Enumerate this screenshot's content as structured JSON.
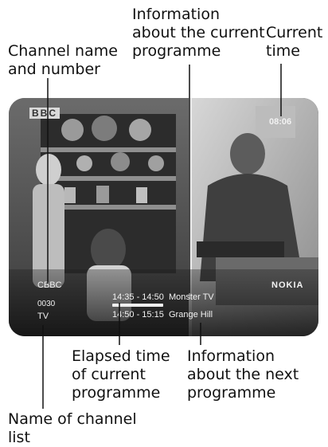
{
  "callouts": {
    "channel_name_number": "Channel name\nand number",
    "current_programme_info": "Information\nabout the current\nprogramme",
    "current_time": "Current\ntime",
    "elapsed_time": "Elapsed time\nof current\nprogramme",
    "next_programme_info": "Information\nabout the next\nprogramme",
    "channel_list_name": "Name of channel\nlist"
  },
  "tv_screen": {
    "logo": "BBC",
    "clock": "08:06",
    "channel_name": "CBBC",
    "channel_number": "0030",
    "channel_list": "TV",
    "current_programme": {
      "time": "14:35 - 14:50",
      "title": "Monster TV"
    },
    "next_programme": {
      "time": "14:50 - 15:15",
      "title": "Grange Hill"
    },
    "brand": "NOKIA",
    "elapsed_fraction": 1.0
  },
  "colors": {
    "overlay_text": "#f2f2f2",
    "leader_lines": "#111111"
  }
}
